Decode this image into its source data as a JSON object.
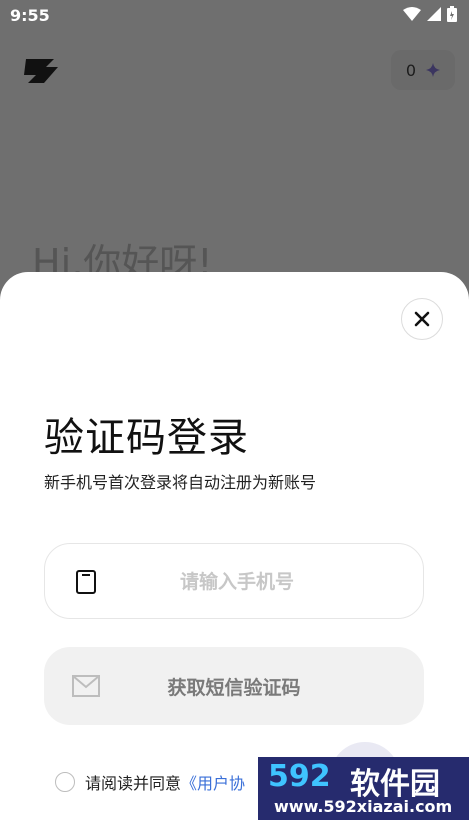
{
  "status_bar": {
    "time": "9:55"
  },
  "header": {
    "credits": "0"
  },
  "greeting": "Hi,你好呀!",
  "login_sheet": {
    "title": "验证码登录",
    "subtitle": "新手机号首次登录将自动注册为新账号",
    "phone_placeholder": "请输入手机号",
    "get_code_label": "获取短信验证码",
    "agree_text": "请阅读并同意",
    "agreement_link": "《用户协"
  },
  "watermark": {
    "brand": "592",
    "brand_cn": "软件园",
    "url": "www.592xiazai.com"
  },
  "colors": {
    "link": "#3a6fd8",
    "sheet_bg": "#ffffff",
    "dim_bg": "#6f6f6f"
  }
}
